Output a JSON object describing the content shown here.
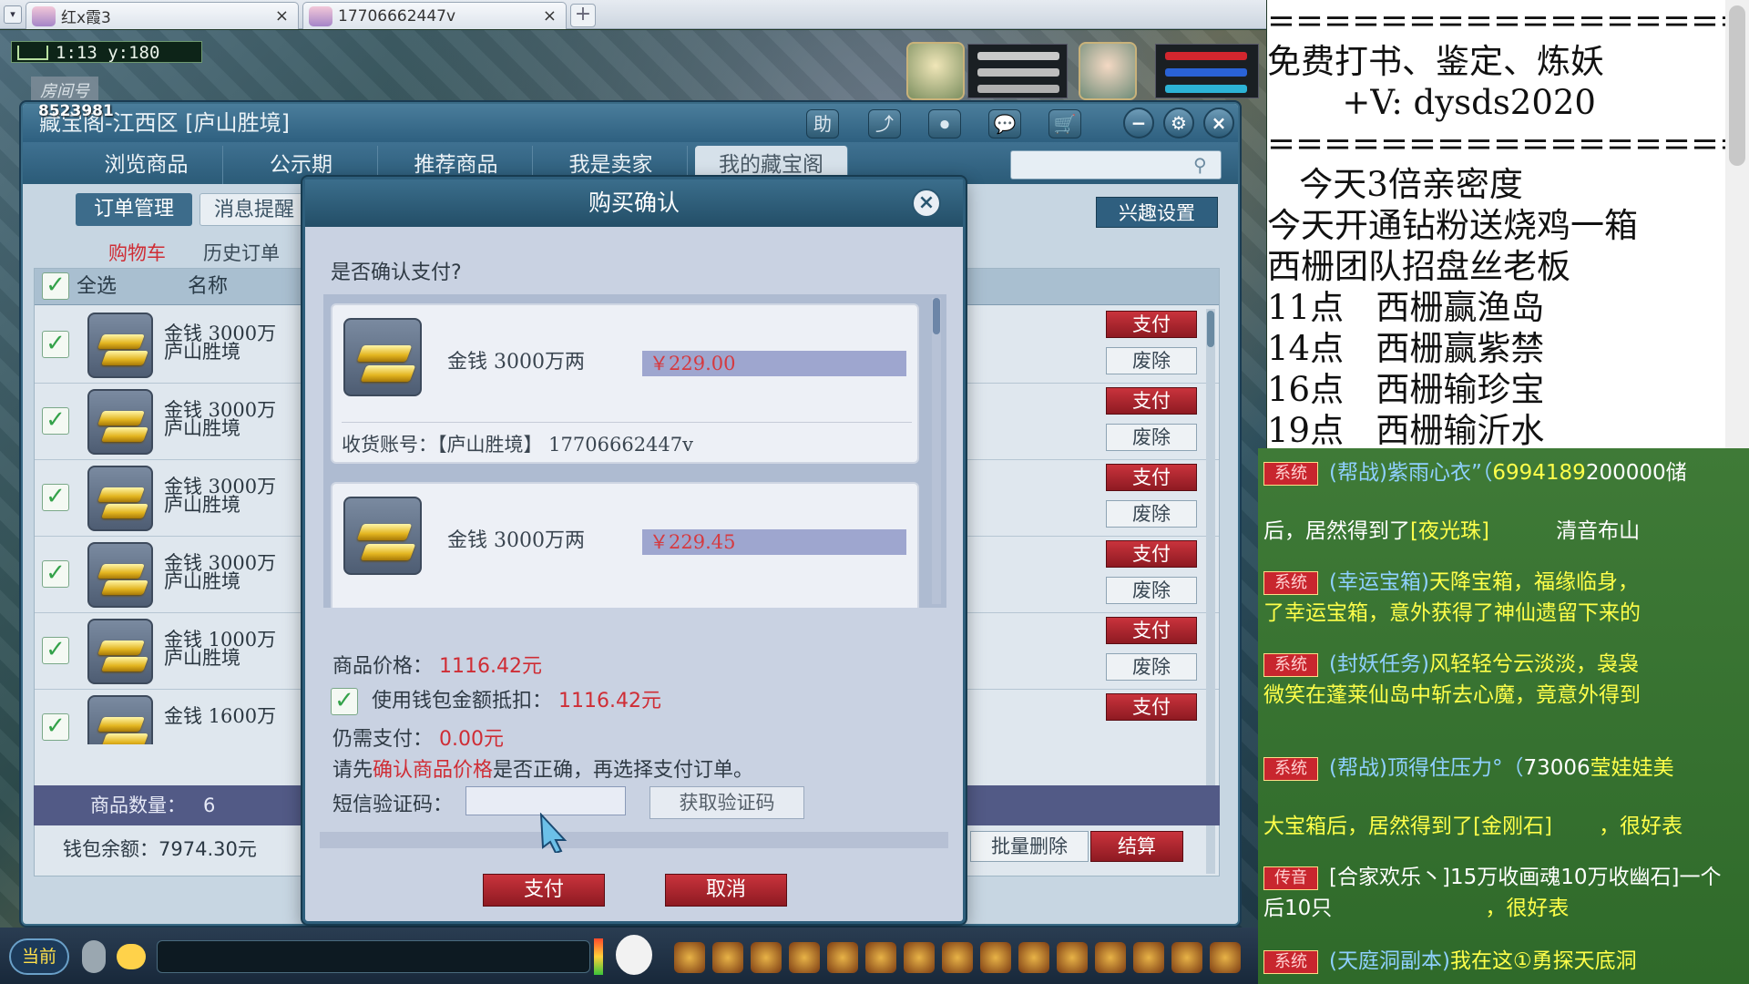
{
  "browser": {
    "tabs": [
      {
        "label": "红x霞3",
        "close": "×"
      },
      {
        "label": "17706662447v",
        "close": "×"
      }
    ],
    "new_tab": "+",
    "menu": "▾"
  },
  "game": {
    "coord": "1:13 y:180",
    "room_label": "房间号",
    "room_number": "8523981"
  },
  "window": {
    "title": "藏宝阁-江西区 [庐山胜境]",
    "toolbar": [
      "助",
      "⤴",
      "⏺",
      "💬",
      "🛒"
    ],
    "controls": [
      "−",
      "⚙",
      "×"
    ],
    "nav_tabs": [
      "浏览商品",
      "公示期",
      "推荐商品",
      "我是卖家",
      "我的藏宝阁"
    ],
    "active_nav": "我的藏宝阁",
    "sub_tabs": [
      "订单管理",
      "消息提醒"
    ],
    "interest_btn": "兴趣设置",
    "links": [
      "购物车",
      "历史订单"
    ],
    "grid_head": {
      "select_all": "全选",
      "name": "名称"
    },
    "rows": [
      {
        "name1": "金钱 3000万",
        "name2": "庐山胜境",
        "pay": "支付",
        "del": "废除"
      },
      {
        "name1": "金钱 3000万",
        "name2": "庐山胜境",
        "pay": "支付",
        "del": "废除"
      },
      {
        "name1": "金钱 3000万",
        "name2": "庐山胜境",
        "pay": "支付",
        "del": "废除"
      },
      {
        "name1": "金钱 3000万",
        "name2": "庐山胜境",
        "pay": "支付",
        "del": "废除"
      },
      {
        "name1": "金钱 1000万",
        "name2": "庐山胜境",
        "pay": "支付",
        "del": "废除"
      },
      {
        "name1": "金钱 1600万",
        "name2": "",
        "pay": "支付",
        "del": ""
      }
    ],
    "item_count_label": "商品数量：",
    "item_count": "6",
    "wallet_label": "钱包余额：",
    "wallet_value": "7974.30元",
    "batch_delete": "批量删除",
    "settle": "结算"
  },
  "dialog": {
    "title": "购买确认",
    "close": "×",
    "question": "是否确认支付?",
    "orders": [
      {
        "name": "金钱  3000万两",
        "price": "￥229.00",
        "account": "收货账号：【庐山胜境】 17706662447v"
      },
      {
        "name": "金钱  3000万两",
        "price": "￥229.45",
        "account": ""
      }
    ],
    "price_label": "商品价格：",
    "price_value": "1116.42元",
    "wallet_deduct_label": "使用钱包金额抵扣：",
    "wallet_deduct_value": "1116.42元",
    "need_pay_label": "仍需支付：",
    "need_pay_value": "0.00元",
    "notice_pre": "请先",
    "notice_red": "确认商品价格",
    "notice_post": "是否正确，再选择支付订单。",
    "sms_label": "短信验证码：",
    "sms_placeholder": "",
    "get_code": "获取验证码",
    "pay": "支付",
    "cancel": "取消"
  },
  "hud": {
    "current_channel": "当前"
  },
  "right_panel": {
    "lines": [
      "=======================",
      "免费打书、鉴定、炼妖",
      "       +V: dysds2020",
      "=======================",
      "   今天3倍亲密度",
      "今天开通钻粉送烧鸡一箱",
      "西栅团队招盘丝老板",
      "11点   西栅赢渔岛",
      "14点   西栅赢紫禁",
      "16点   西栅输珍宝",
      "19点   西栅输沂水"
    ]
  },
  "chat": {
    "lines": [
      {
        "badge": "系统",
        "parts": [
          {
            "c": "cg",
            "t": "(帮战)紫雨心衣”（"
          },
          {
            "c": "cy",
            "t": "6994189"
          },
          {
            "c": "cw",
            "t": "200000储"
          }
        ]
      },
      {
        "badge": "",
        "parts": [
          {
            "c": "cw",
            "t": "后，居然得到了"
          },
          {
            "c": "cy",
            "t": "[夜光珠]"
          },
          {
            "c": "cw",
            "t": "          清音布山"
          }
        ]
      },
      {
        "badge": "系统",
        "parts": [
          {
            "c": "cg",
            "t": "(幸运宝箱)"
          },
          {
            "c": "cy",
            "t": "天降宝箱，福缘临身，"
          }
        ]
      },
      {
        "badge": "",
        "parts": [
          {
            "c": "cy",
            "t": "了幸运宝箱，意外获得了神仙遗留下来的"
          }
        ]
      },
      {
        "badge": "系统",
        "parts": [
          {
            "c": "cg",
            "t": "(封妖任务)"
          },
          {
            "c": "cy",
            "t": "风轻轻兮云淡淡，袅袅"
          }
        ]
      },
      {
        "badge": "",
        "parts": [
          {
            "c": "cy",
            "t": "微笑在蓬莱仙岛中斩去心魔，竟意外得到"
          }
        ]
      },
      {
        "badge": "系统",
        "parts": [
          {
            "c": "cg",
            "t": "(帮战)顶得住压力°（"
          },
          {
            "c": "cw",
            "t": "73006"
          },
          {
            "c": "cy",
            "t": "莹娃娃美"
          }
        ]
      },
      {
        "badge": "",
        "parts": [
          {
            "c": "cy",
            "t": "大宝箱后，居然得到了[金刚石]"
          },
          {
            "c": "cy",
            "t": "       ，很好表"
          }
        ]
      },
      {
        "badge": "传音",
        "parts": [
          {
            "c": "cw",
            "t": "[合家欢乐丶]15万收画魂10万收幽石]一个"
          }
        ]
      },
      {
        "badge": "",
        "parts": [
          {
            "c": "cw",
            "t": "后10只"
          },
          {
            "c": "cy",
            "t": "                       ，很好表"
          }
        ]
      },
      {
        "badge": "系统",
        "parts": [
          {
            "c": "cg",
            "t": "(天庭洞副本)"
          },
          {
            "c": "cy",
            "t": "我在这①勇探天底洞"
          }
        ]
      }
    ]
  },
  "colors": {
    "accent": "#2e5e7b",
    "pay_red": "#b82630",
    "price_red": "#cf2d35",
    "check_green": "#34a24a"
  }
}
